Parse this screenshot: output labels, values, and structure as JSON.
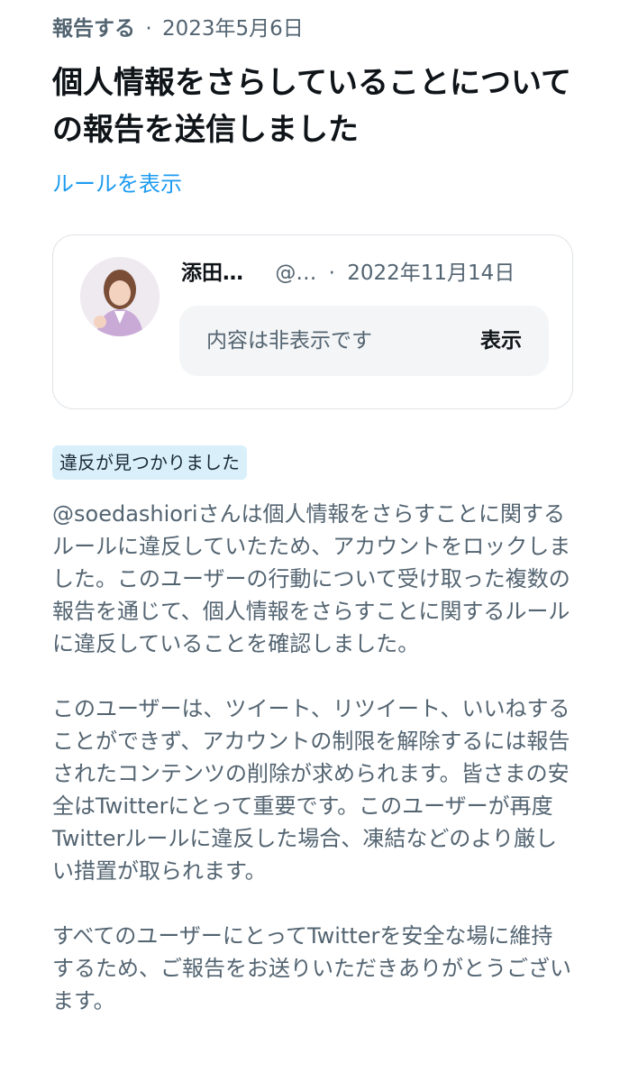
{
  "header": {
    "report_label": "報告する",
    "separator": "·",
    "report_date": "2023年5月6日",
    "title": "個人情報をさらしていることについての報告を送信しました",
    "rules_link": "ルールを表示"
  },
  "tweet": {
    "display_name": "添田…",
    "handle": "@…",
    "separator": "·",
    "date": "2022年11月14日",
    "hidden_text": "内容は非表示です",
    "show_label": "表示"
  },
  "badge": {
    "label": "違反が見つかりました"
  },
  "body": {
    "paragraph1": "@soedashioriさんは個人情報をさらすことに関するルールに違反していたため、アカウントをロックしました。このユーザーの行動について受け取った複数の報告を通じて、個人情報をさらすことに関するルールに違反していることを確認しました。",
    "paragraph2": "このユーザーは、ツイート、リツイート、いいねすることができず、アカウントの制限を解除するには報告されたコンテンツの削除が求められます。皆さまの安全はTwitterにとって重要です。このユーザーが再度Twitterルールに違反した場合、凍結などのより厳しい措置が取られます。",
    "paragraph3": "すべてのユーザーにとってTwitterを安全な場に維持するため、ご報告をお送りいただきありがとうございます。"
  },
  "colors": {
    "link": "#1d9bf0",
    "secondary_text": "#536471",
    "primary_text": "#0f1419",
    "badge_bg": "#d9f0fb",
    "card_border": "#dfe3e7",
    "hidden_box_bg": "#f4f5f6"
  }
}
